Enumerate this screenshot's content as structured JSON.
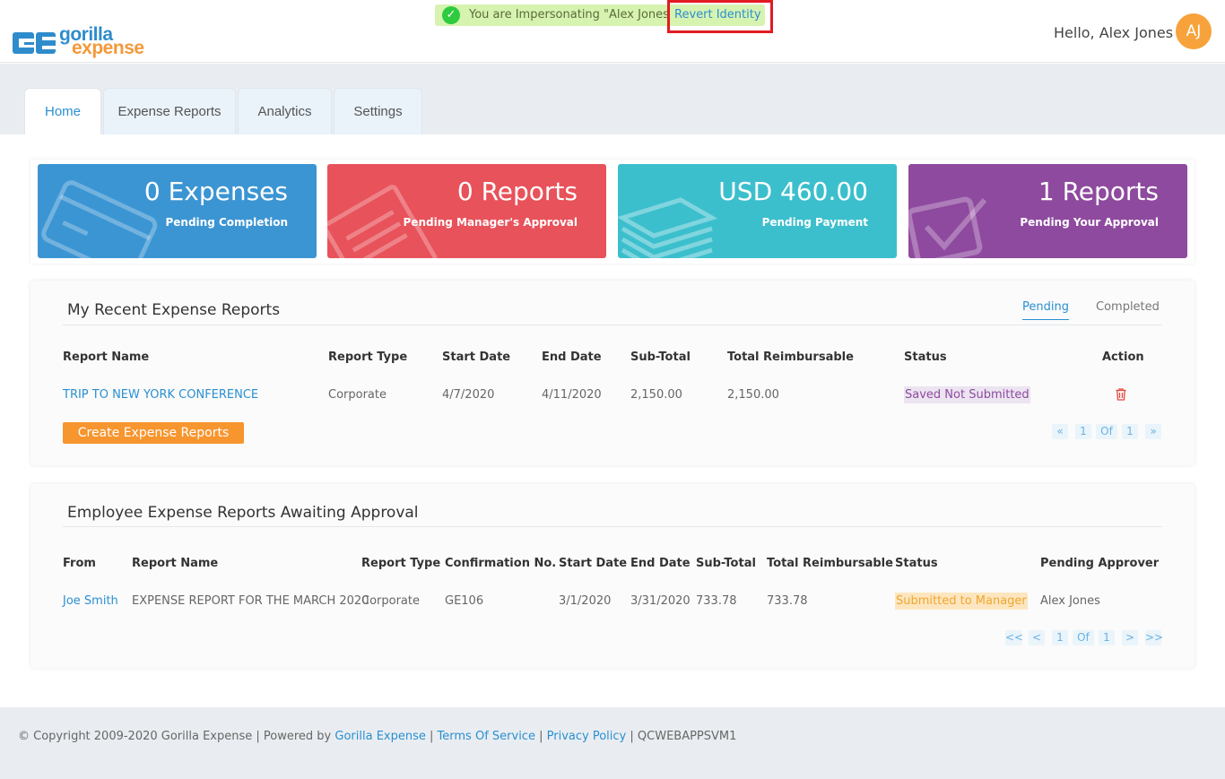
{
  "header": {
    "logo_word1": "gorilla",
    "logo_word2": "expense",
    "impersonation_message": "You are Impersonating \"Alex Jones\"",
    "revert_label": "Revert Identity",
    "greeting": "Hello, Alex Jones",
    "avatar_initials": "AJ"
  },
  "tabs": [
    {
      "label": "Home",
      "active": true
    },
    {
      "label": "Expense Reports",
      "active": false
    },
    {
      "label": "Analytics",
      "active": false
    },
    {
      "label": "Settings",
      "active": false
    }
  ],
  "cards": [
    {
      "value": "0 Expenses",
      "caption": "Pending Completion",
      "color": "#3c95d3",
      "icon": "credit-card-icon"
    },
    {
      "value": "0 Reports",
      "caption": "Pending Manager's Approval",
      "color": "#e8525a",
      "icon": "report-icon"
    },
    {
      "value": "USD 460.00",
      "caption": "Pending Payment",
      "color": "#3cbfcd",
      "icon": "money-stack-icon"
    },
    {
      "value": "1 Reports",
      "caption": "Pending Your Approval",
      "color": "#8e4a9e",
      "icon": "checkbox-icon"
    }
  ],
  "recent": {
    "title": "My Recent Expense Reports",
    "subtabs": {
      "pending": "Pending",
      "completed": "Completed"
    },
    "headers": [
      "Report Name",
      "Report Type",
      "Start Date",
      "End Date",
      "Sub-Total",
      "Total Reimbursable",
      "Status",
      "Action"
    ],
    "rows": [
      {
        "name": "TRIP TO NEW YORK CONFERENCE",
        "type": "Corporate",
        "start": "4/7/2020",
        "end": "4/11/2020",
        "subtotal": "2,150.00",
        "total": "2,150.00",
        "status": "Saved Not Submitted"
      }
    ],
    "create_label": "Create Expense Reports",
    "pager": {
      "prev": "«",
      "page": "1",
      "of": "Of",
      "total": "1",
      "next": "»"
    }
  },
  "awaiting": {
    "title": "Employee Expense Reports Awaiting Approval",
    "headers": [
      "From",
      "Report Name",
      "Report Type",
      "Confirmation No.",
      "Start Date",
      "End Date",
      "Sub-Total",
      "Total Reimbursable",
      "Status",
      "Pending Approver"
    ],
    "rows": [
      {
        "from": "Joe Smith",
        "name": "EXPENSE REPORT FOR THE MARCH 2020",
        "type": "Corporate",
        "confirmation": "GE106",
        "start": "3/1/2020",
        "end": "3/31/2020",
        "subtotal": "733.78",
        "total": "733.78",
        "status": "Submitted to Manager",
        "approver": "Alex Jones"
      }
    ],
    "pager": {
      "first": "<<",
      "prev": "<",
      "page": "1",
      "of": "Of",
      "total": "1",
      "next": ">",
      "last": ">>"
    }
  },
  "footer": {
    "copyright": "© Copyright 2009-2020 Gorilla Expense | Powered by",
    "powered_link": "Gorilla Expense",
    "sep": "|",
    "terms": "Terms Of Service",
    "privacy": "Privacy Policy",
    "server": "QCWEBAPPSVM1"
  }
}
